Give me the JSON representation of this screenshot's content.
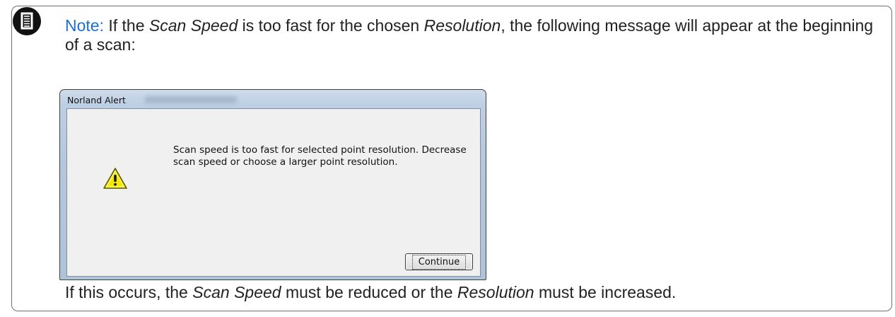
{
  "note": {
    "label": "Note:",
    "text_1": " If the ",
    "em_1": "Scan Speed",
    "text_2": " is too fast for the chosen ",
    "em_2": "Resolution",
    "text_3": ", the following message will appear at the beginning of a scan:",
    "icon": "document-note-icon"
  },
  "dialog": {
    "title": "Norland Alert",
    "message": "Scan speed is too fast for selected point resolution. Decrease scan speed or choose a larger point resolution.",
    "button_label": "Continue",
    "icon": "warning-icon"
  },
  "footer": {
    "text_1": "If this occurs, the ",
    "em_1": "Scan Speed",
    "text_2": " must be reduced or the ",
    "em_2": "Resolution",
    "text_3": " must be increased."
  },
  "colors": {
    "note_label": "#1f6fd4",
    "border": "#6f6f6f",
    "dialog_frame": "#b4c8dd",
    "warning_yellow": "#f5e900"
  }
}
